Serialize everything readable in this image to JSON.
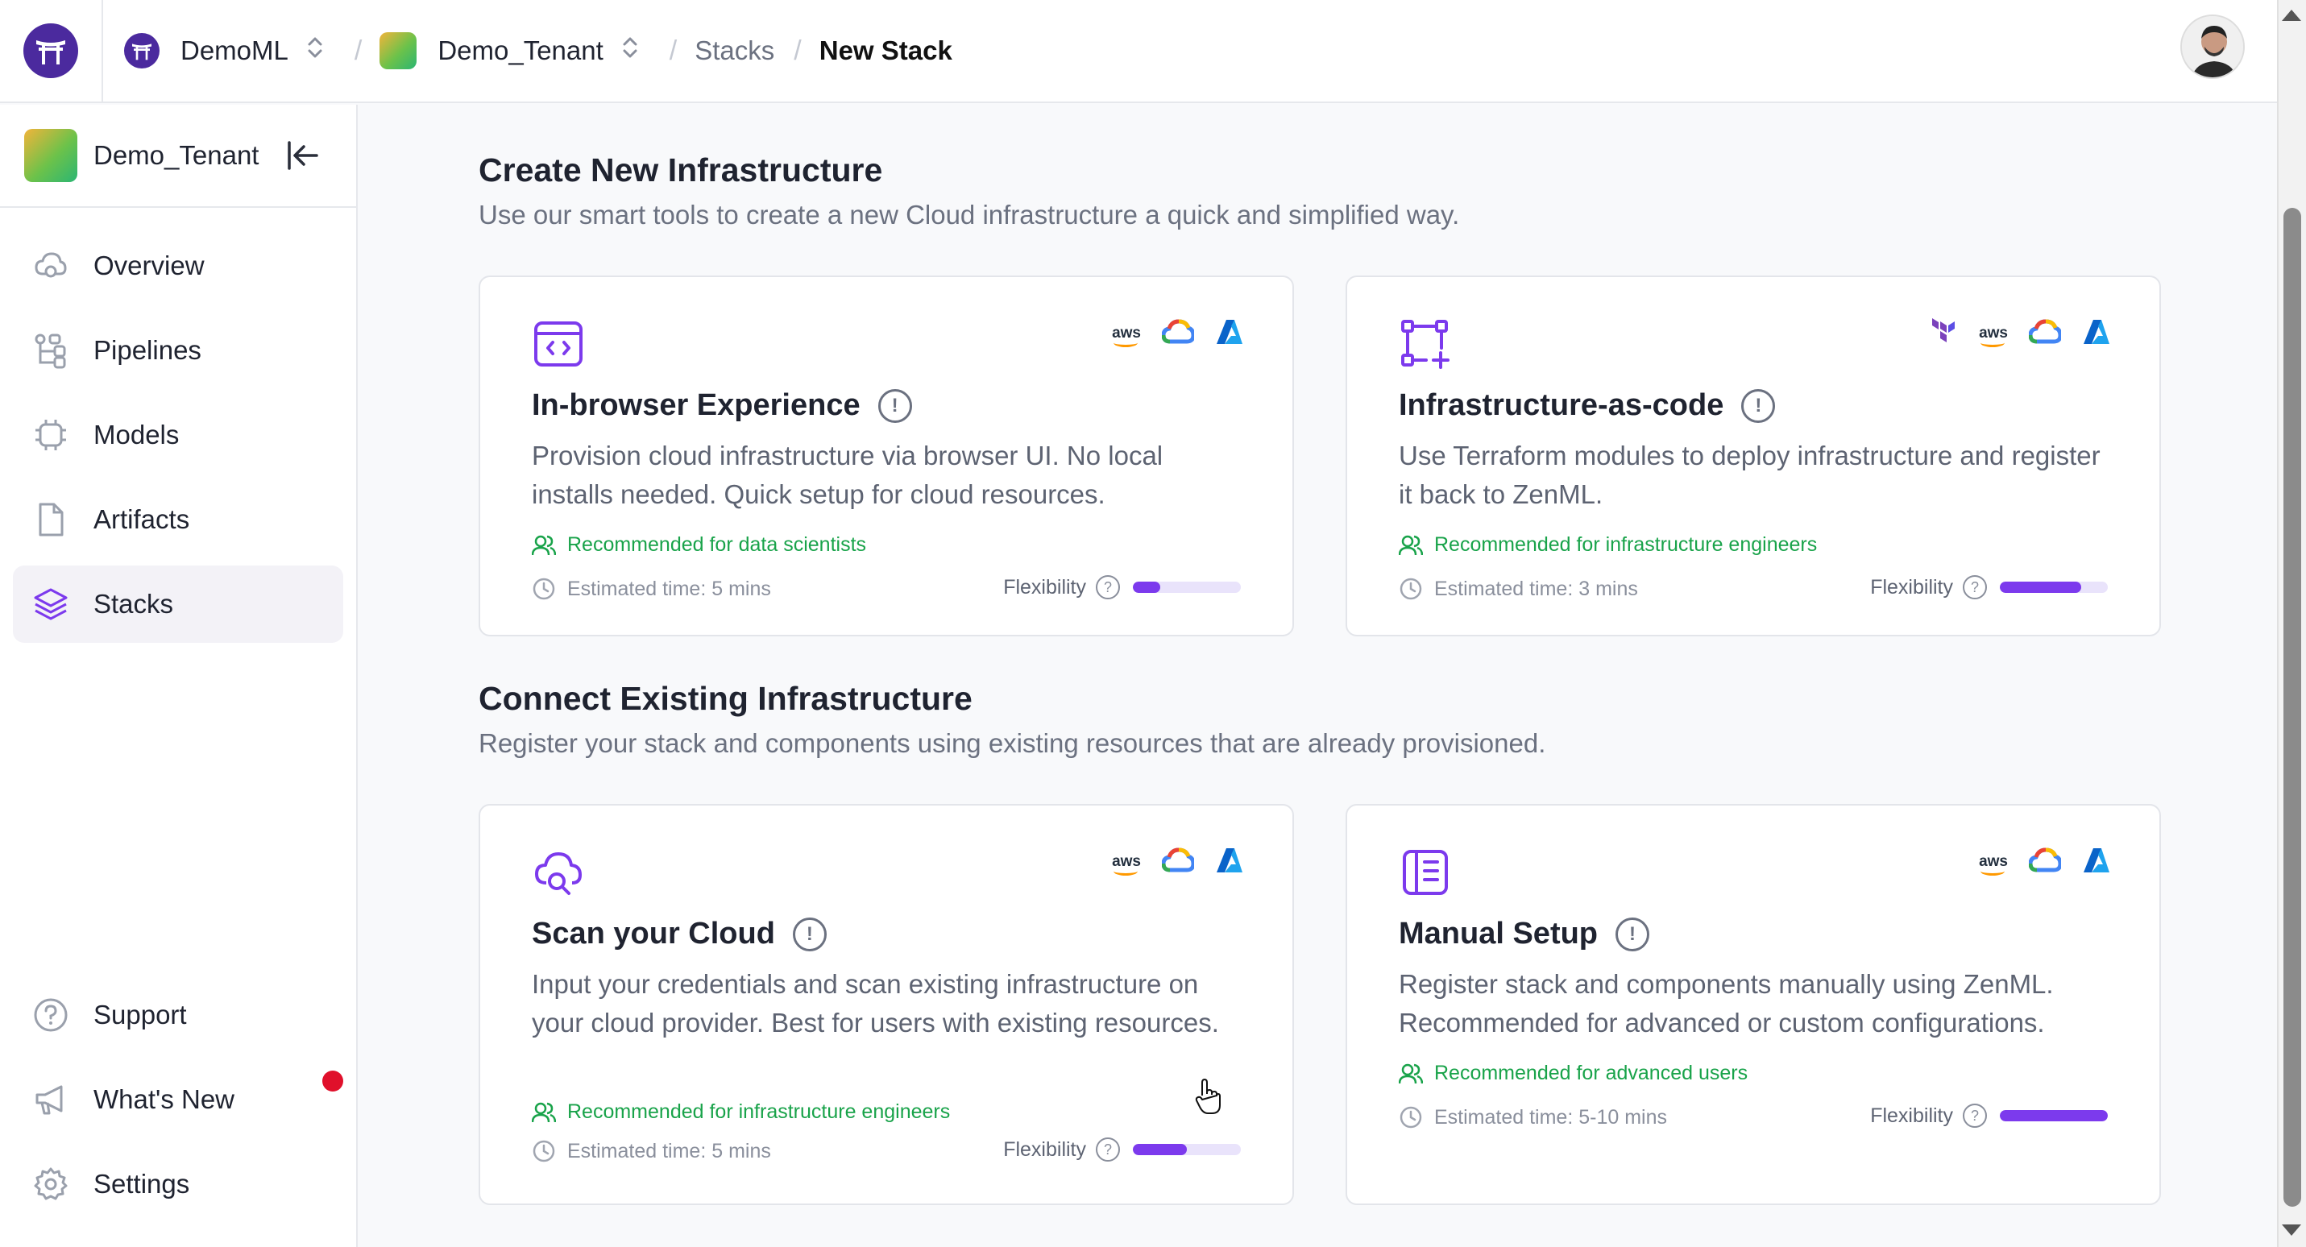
{
  "topbar": {
    "org_name": "DemoML",
    "tenant_name": "Demo_Tenant",
    "crumb_stacks": "Stacks",
    "crumb_current": "New Stack"
  },
  "sidebar": {
    "tenant_name": "Demo_Tenant",
    "items": [
      {
        "label": "Overview",
        "icon": "cloud-icon"
      },
      {
        "label": "Pipelines",
        "icon": "pipeline-icon"
      },
      {
        "label": "Models",
        "icon": "chip-icon"
      },
      {
        "label": "Artifacts",
        "icon": "file-icon"
      },
      {
        "label": "Stacks",
        "icon": "layers-icon",
        "active": true
      }
    ],
    "bottom_items": [
      {
        "label": "Support",
        "icon": "help-icon"
      },
      {
        "label": "What's New",
        "icon": "megaphone-icon",
        "badge": "red-dot"
      },
      {
        "label": "Settings",
        "icon": "gear-icon"
      }
    ]
  },
  "create": {
    "title": "Create New Infrastructure",
    "subtitle": "Use our smart tools to create a new Cloud infrastructure a quick and simplified way."
  },
  "connect": {
    "title": "Connect Existing Infrastructure",
    "subtitle": "Register your stack and components using existing resources that are already provisioned."
  },
  "cards": [
    {
      "title": "In-browser Experience",
      "description": "Provision cloud infrastructure via browser UI. No local installs needed. Quick setup for cloud resources.",
      "recommended": "Recommended for data scientists",
      "estimated": "Estimated time: 5 mins",
      "flexibility_label": "Flexibility",
      "flexibility": 0.25,
      "providers": [
        "aws",
        "gcp",
        "azure"
      ]
    },
    {
      "title": "Infrastructure-as-code",
      "description": "Use Terraform modules to deploy infrastructure and register it back to ZenML.",
      "recommended": "Recommended for infrastructure engineers",
      "estimated": "Estimated time: 3 mins",
      "flexibility_label": "Flexibility",
      "flexibility": 0.75,
      "providers": [
        "terraform",
        "aws",
        "gcp",
        "azure"
      ]
    },
    {
      "title": "Scan your Cloud",
      "description": "Input your credentials and scan existing infrastructure on your cloud provider. Best for users with existing resources.",
      "recommended": "Recommended for infrastructure engineers",
      "estimated": "Estimated time: 5 mins",
      "flexibility_label": "Flexibility",
      "flexibility": 0.5,
      "providers": [
        "aws",
        "gcp",
        "azure"
      ]
    },
    {
      "title": "Manual Setup",
      "description": "Register stack and components manually using ZenML. Recommended for advanced or custom configurations.",
      "recommended": "Recommended for advanced users",
      "estimated": "Estimated time: 5-10 mins",
      "flexibility_label": "Flexibility",
      "flexibility": 1.0,
      "providers": [
        "aws",
        "gcp",
        "azure"
      ]
    }
  ],
  "provider_labels": {
    "aws": "aws"
  },
  "colors": {
    "accent": "#7c3aed",
    "recommended": "#19a34a",
    "notification": "#e0102b"
  }
}
